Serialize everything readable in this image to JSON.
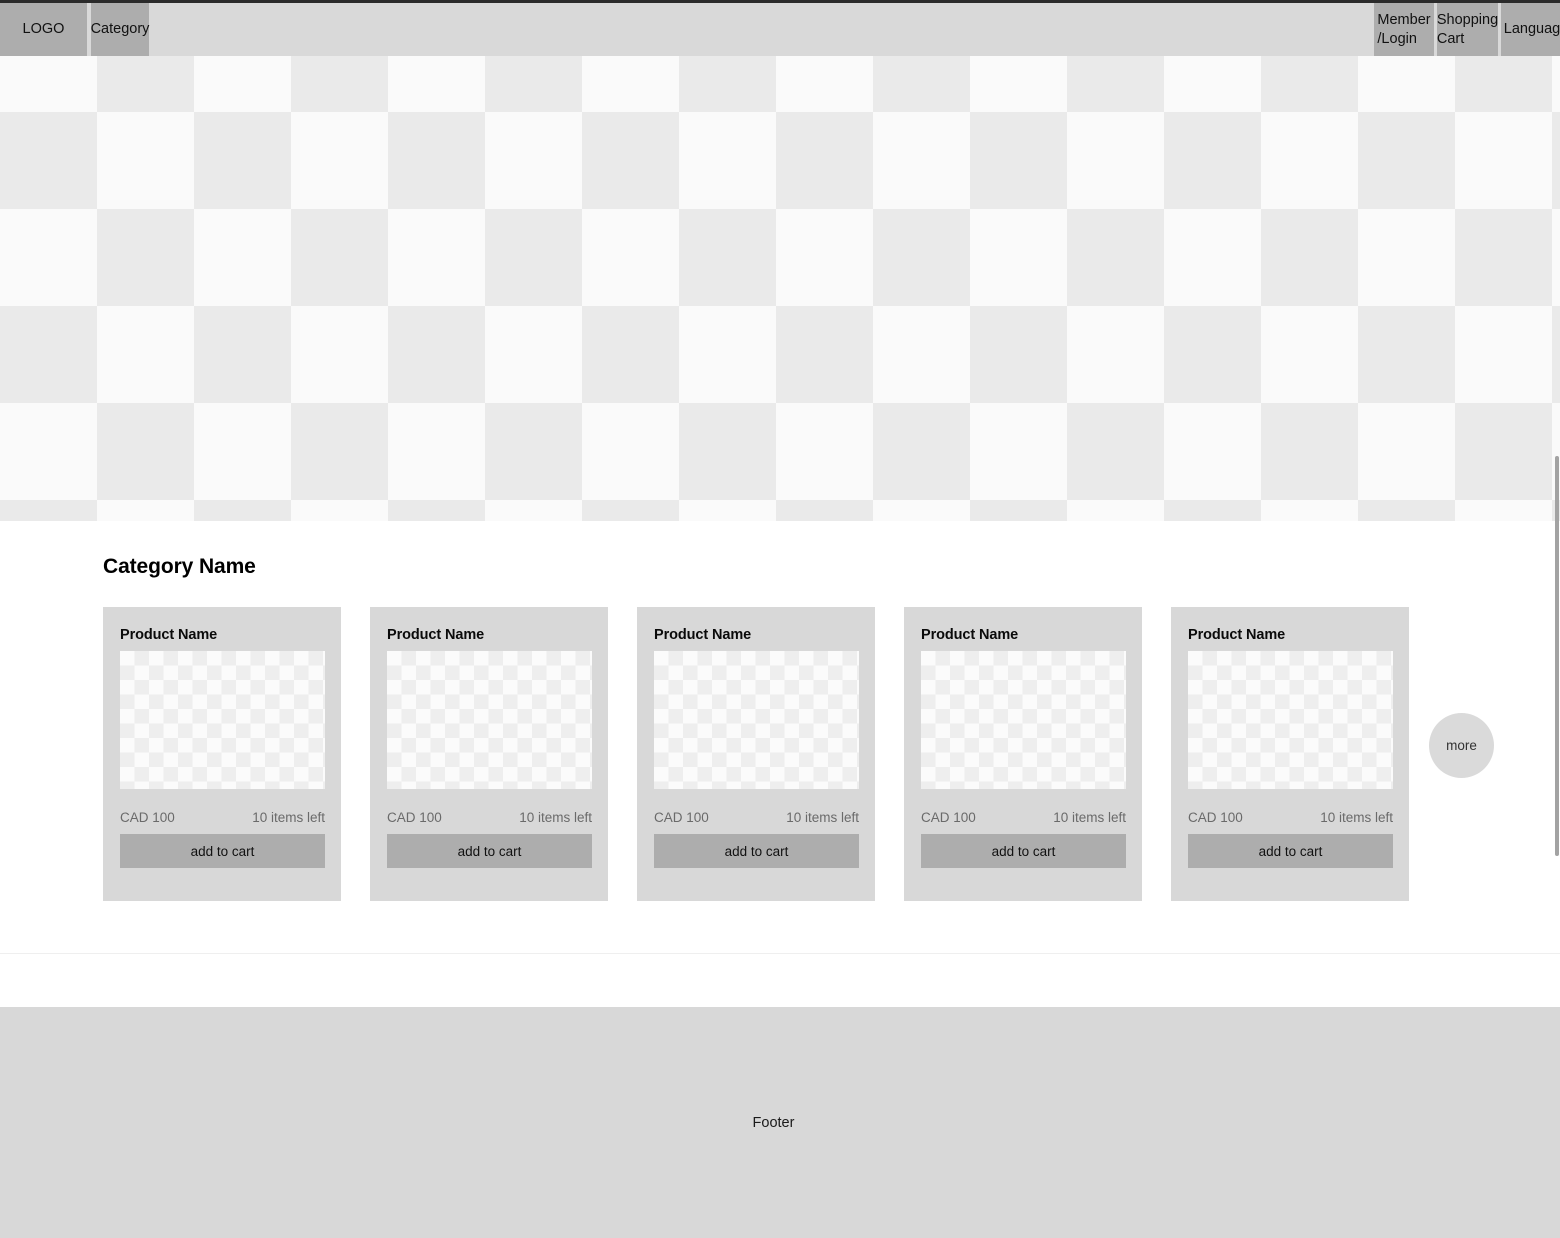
{
  "header": {
    "logo_label": "LOGO",
    "category_label": "Category",
    "member_label": "Member\n/Login",
    "cart_label": "Shopping\nCart",
    "language_label": "Language"
  },
  "hero": {
    "placeholder_type": "checkerboard-image-placeholder"
  },
  "main": {
    "section_title": "Category Name",
    "more_label": "more",
    "products": [
      {
        "name": "Product Name",
        "price": "CAD 100",
        "stock": "10 items left",
        "cta": "add to cart"
      },
      {
        "name": "Product Name",
        "price": "CAD 100",
        "stock": "10 items left",
        "cta": "add to cart"
      },
      {
        "name": "Product Name",
        "price": "CAD 100",
        "stock": "10 items left",
        "cta": "add to cart"
      },
      {
        "name": "Product Name",
        "price": "CAD 100",
        "stock": "10 items left",
        "cta": "add to cart"
      },
      {
        "name": "Product Name",
        "price": "CAD 100",
        "stock": "10 items left",
        "cta": "add to cart"
      }
    ]
  },
  "footer": {
    "label": "Footer"
  },
  "colors": {
    "header_bg": "#d9d9d9",
    "nav_block_bg": "#adadad",
    "card_bg": "#d8d8d8",
    "button_bg": "#adadad",
    "more_bg": "#dadada",
    "footer_bg": "#d8d8d8",
    "checker_light": "#fafafa",
    "checker_dark": "#eaeaea"
  }
}
